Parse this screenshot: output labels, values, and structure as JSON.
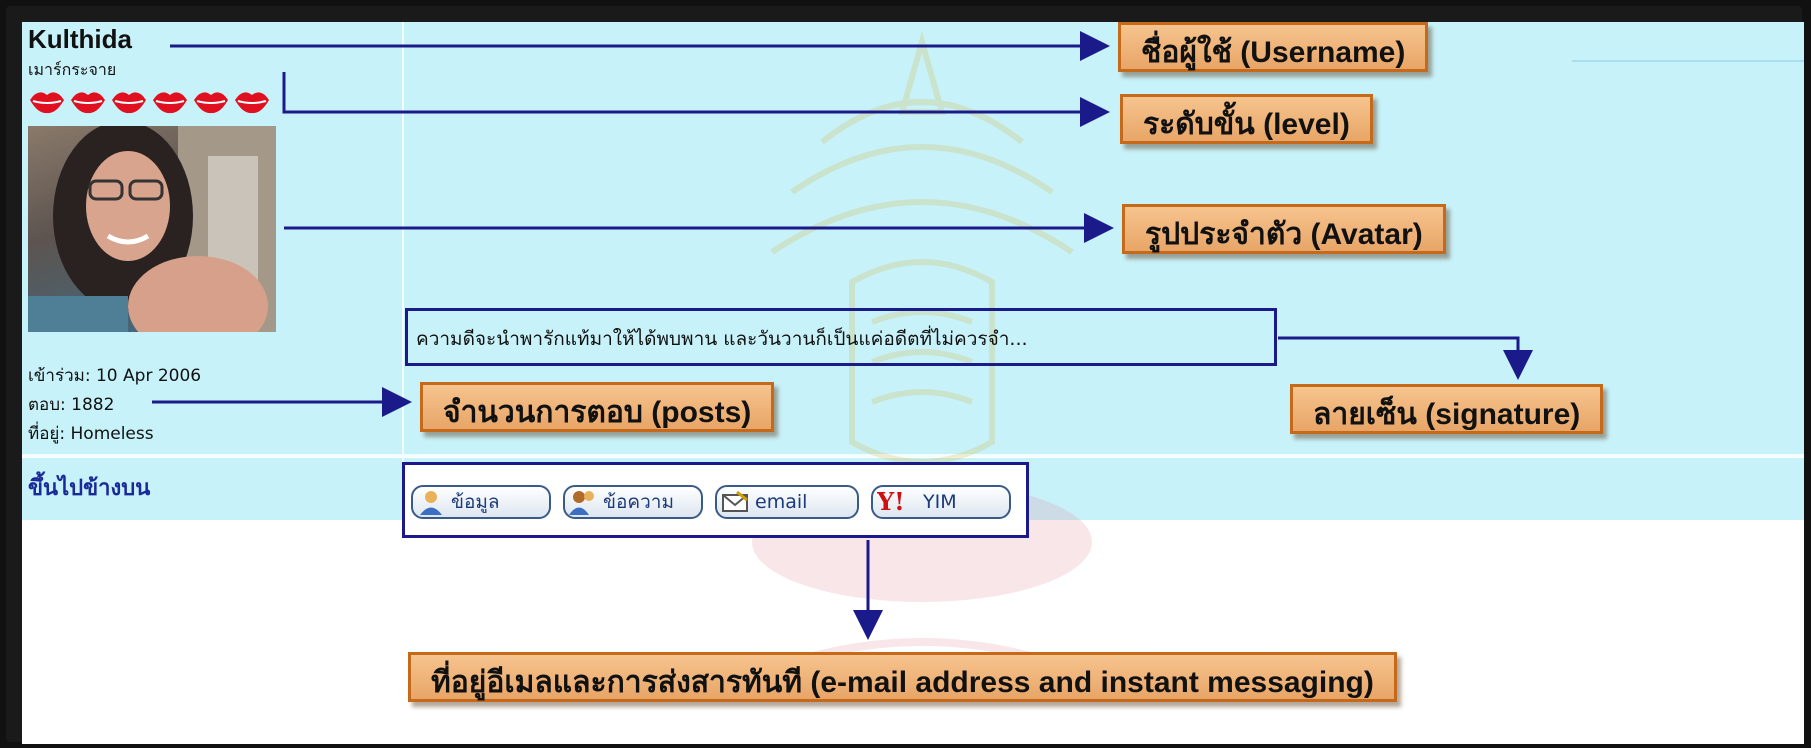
{
  "profile": {
    "username": "Kulthida",
    "rank_title": "เมาร์กระจาย",
    "level_icons": 6,
    "joined": "เข้าร่วม: 10 Apr 2006",
    "posts": "ตอบ: 1882",
    "location": "ที่อยู่: Homeless"
  },
  "back_to_top": "ขึ้นไปข้างบน",
  "signature_text": "ความดีจะนำพารักแท้มาให้ได้พบพาน และวันวานก็เป็นแค่อดีตที่ไม่ควรจำ...",
  "buttons": {
    "info": "ข้อมูล",
    "message": "ข้อความ",
    "email": "email",
    "yim": "YIM"
  },
  "annotations": {
    "username": "ชื่อผู้ใช้ (Username)",
    "level": "ระดับขั้น (level)",
    "avatar": "รูปประจำตัว (Avatar)",
    "posts": "จำนวนการตอบ (posts)",
    "signature": "ลายเซ็น (signature)",
    "contact": "ที่อยู่อีเมลและการส่งสารทันที (e-mail address and instant messaging)"
  },
  "colors": {
    "panel_bg": "#c8f2fa",
    "arrow": "#1a1a8a",
    "label_bg": "#f0b47a",
    "label_border": "#c56a1a",
    "link": "#1a2a99"
  }
}
